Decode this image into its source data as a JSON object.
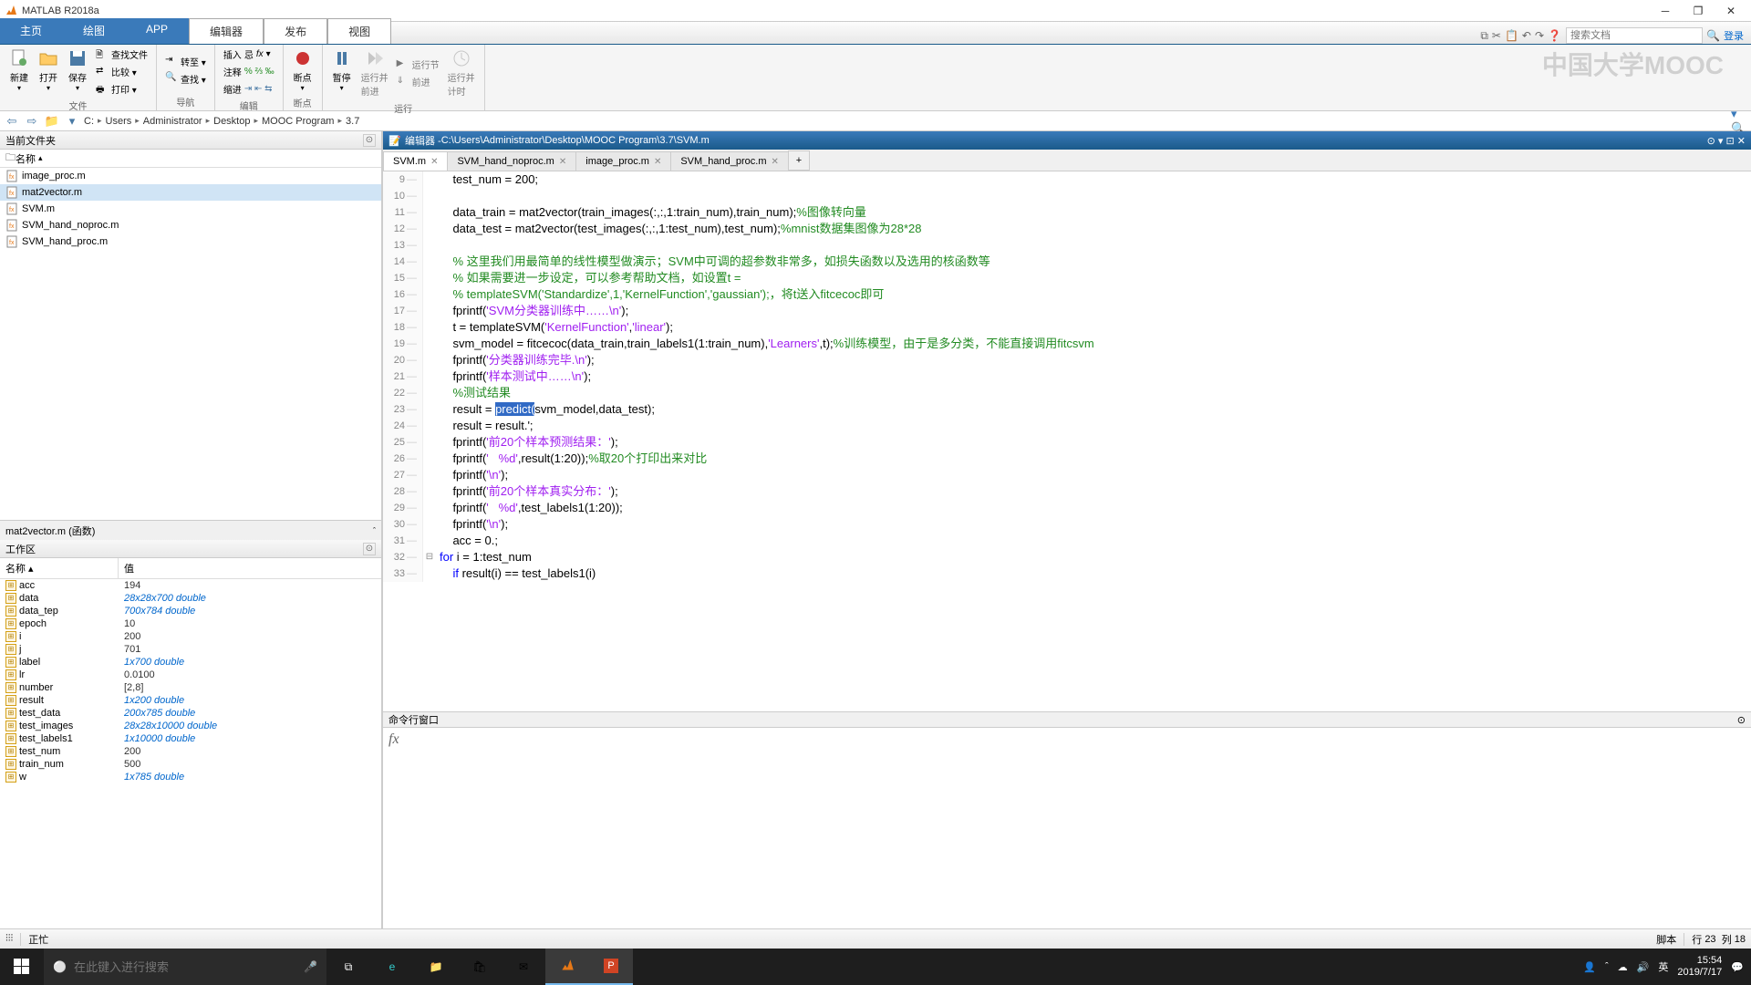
{
  "title": "MATLAB R2018a",
  "watermark": "中国大学MOOC",
  "ribbon": {
    "tabs": [
      "主页",
      "绘图",
      "APP",
      "编辑器",
      "发布",
      "视图"
    ],
    "active_index": 3,
    "search_placeholder": "搜索文档",
    "login": "登录"
  },
  "toolgroups": {
    "file": {
      "label": "文件",
      "newbtn": "新建",
      "openbtn": "打开",
      "savebtn": "保存",
      "findfiles": "查找文件",
      "compare": "比较 ▾",
      "print": "打印 ▾"
    },
    "nav": {
      "label": "导航",
      "goto": "转至 ▾",
      "find": "查找 ▾"
    },
    "edit": {
      "label": "编辑",
      "insert": "插入",
      "comment": "注释",
      "indent": "缩进"
    },
    "breakpoint": {
      "label": "断点",
      "btn": "断点"
    },
    "run": {
      "label": "运行",
      "pause": "暂停",
      "runadv": "运行并\n前进",
      "runsection": "运行节",
      "advance": "前进",
      "runtime": "运行并\n计时"
    }
  },
  "path": {
    "segs": [
      "C:",
      "Users",
      "Administrator",
      "Desktop",
      "MOOC Program",
      "3.7"
    ]
  },
  "currentFolder": {
    "title": "当前文件夹",
    "nameCol": "名称",
    "files": [
      {
        "name": "image_proc.m"
      },
      {
        "name": "mat2vector.m",
        "selected": true
      },
      {
        "name": "SVM.m"
      },
      {
        "name": "SVM_hand_noproc.m"
      },
      {
        "name": "SVM_hand_proc.m"
      }
    ],
    "details": "mat2vector.m  (函数)"
  },
  "workspace": {
    "title": "工作区",
    "nameCol": "名称 ▴",
    "valCol": "值",
    "vars": [
      {
        "name": "acc",
        "val": "194"
      },
      {
        "name": "data",
        "val": "28x28x700 double",
        "italic": true
      },
      {
        "name": "data_tep",
        "val": "700x784 double",
        "italic": true
      },
      {
        "name": "epoch",
        "val": "10"
      },
      {
        "name": "i",
        "val": "200"
      },
      {
        "name": "j",
        "val": "701"
      },
      {
        "name": "label",
        "val": "1x700 double",
        "italic": true
      },
      {
        "name": "lr",
        "val": "0.0100"
      },
      {
        "name": "number",
        "val": "[2,8]"
      },
      {
        "name": "result",
        "val": "1x200 double",
        "italic": true
      },
      {
        "name": "test_data",
        "val": "200x785 double",
        "italic": true
      },
      {
        "name": "test_images",
        "val": "28x28x10000 double",
        "italic": true
      },
      {
        "name": "test_labels1",
        "val": "1x10000 double",
        "italic": true
      },
      {
        "name": "test_num",
        "val": "200"
      },
      {
        "name": "train_num",
        "val": "500"
      },
      {
        "name": "w",
        "val": "1x785 double",
        "italic": true
      }
    ]
  },
  "editor": {
    "headerPrefix": "编辑器 - ",
    "headerPath": "C:\\Users\\Administrator\\Desktop\\MOOC Program\\3.7\\SVM.m",
    "tabs": [
      {
        "label": "SVM.m",
        "active": true
      },
      {
        "label": "SVM_hand_noproc.m"
      },
      {
        "label": "image_proc.m"
      },
      {
        "label": "SVM_hand_proc.m"
      }
    ],
    "lines": [
      {
        "n": 9,
        "html": "    test_num = 200;"
      },
      {
        "n": 10,
        "html": ""
      },
      {
        "n": 11,
        "html": "    data_train = mat2vector(train_images(:,:,1:train_num),train_num);<span class='c-comment'>%图像转向量</span>"
      },
      {
        "n": 12,
        "html": "    data_test = mat2vector(test_images(:,:,1:test_num),test_num);<span class='c-comment'>%mnist数据集图像为28*28</span>"
      },
      {
        "n": 13,
        "html": ""
      },
      {
        "n": 14,
        "html": "    <span class='c-comment'>% 这里我们用最简单的线性模型做演示；SVM中可调的超参数非常多，如损失函数以及选用的核函数等</span>"
      },
      {
        "n": 15,
        "html": "    <span class='c-comment'>% 如果需要进一步设定，可以参考帮助文档，如设置t =</span>"
      },
      {
        "n": 16,
        "html": "    <span class='c-comment'>% templateSVM('Standardize',1,'KernelFunction','gaussian');，将t送入fitcecoc即可</span>"
      },
      {
        "n": 17,
        "html": "    fprintf(<span class='c-string'>'SVM分类器训练中……\\n'</span>);"
      },
      {
        "n": 18,
        "html": "    t = templateSVM(<span class='c-string'>'KernelFunction'</span>,<span class='c-string'>'linear'</span>);"
      },
      {
        "n": 19,
        "html": "    svm_model = fitcecoc(data_train,train_labels1(1:train_num),<span class='c-string'>'Learners'</span>,t);<span class='c-comment'>%训练模型，由于是多分类，不能直接调用fitcsvm</span>"
      },
      {
        "n": 20,
        "html": "    fprintf(<span class='c-string'>'分类器训练完毕.\\n'</span>);"
      },
      {
        "n": 21,
        "html": "    fprintf(<span class='c-string'>'样本测试中……\\n'</span>);"
      },
      {
        "n": 22,
        "html": "    <span class='c-comment'>%测试结果</span>"
      },
      {
        "n": 23,
        "html": "    result = <span class='c-hl'>predict(</span>svm_model,data_test);"
      },
      {
        "n": 24,
        "html": "    result = result.';"
      },
      {
        "n": 25,
        "html": "    fprintf(<span class='c-string'>'前20个样本预测结果：'</span>);"
      },
      {
        "n": 26,
        "html": "    fprintf(<span class='c-string'>'   %d'</span>,result(1:20));<span class='c-comment'>%取20个打印出来对比</span>"
      },
      {
        "n": 27,
        "html": "    fprintf(<span class='c-string'>'\\n'</span>);"
      },
      {
        "n": 28,
        "html": "    fprintf(<span class='c-string'>'前20个样本真实分布：'</span>);"
      },
      {
        "n": 29,
        "html": "    fprintf(<span class='c-string'>'   %d'</span>,test_labels1(1:20));"
      },
      {
        "n": 30,
        "html": "    fprintf(<span class='c-string'>'\\n'</span>);"
      },
      {
        "n": 31,
        "html": "    acc = 0.;"
      },
      {
        "n": 32,
        "html": "<span class='c-keyword'>for</span> i = 1:test_num",
        "fold": "⊟"
      },
      {
        "n": 33,
        "html": "    <span class='c-keyword'>if</span> result(i) == test_labels1(i)"
      }
    ]
  },
  "cmd": {
    "title": "命令行窗口"
  },
  "status": {
    "busy": "正忙",
    "script": "脚本",
    "line": "行",
    "lineVal": "23",
    "col": "列",
    "colVal": "18"
  },
  "taskbar": {
    "searchPlaceholder": "在此键入进行搜索",
    "ime": "英",
    "time": "15:54",
    "date": "2019/7/17"
  }
}
